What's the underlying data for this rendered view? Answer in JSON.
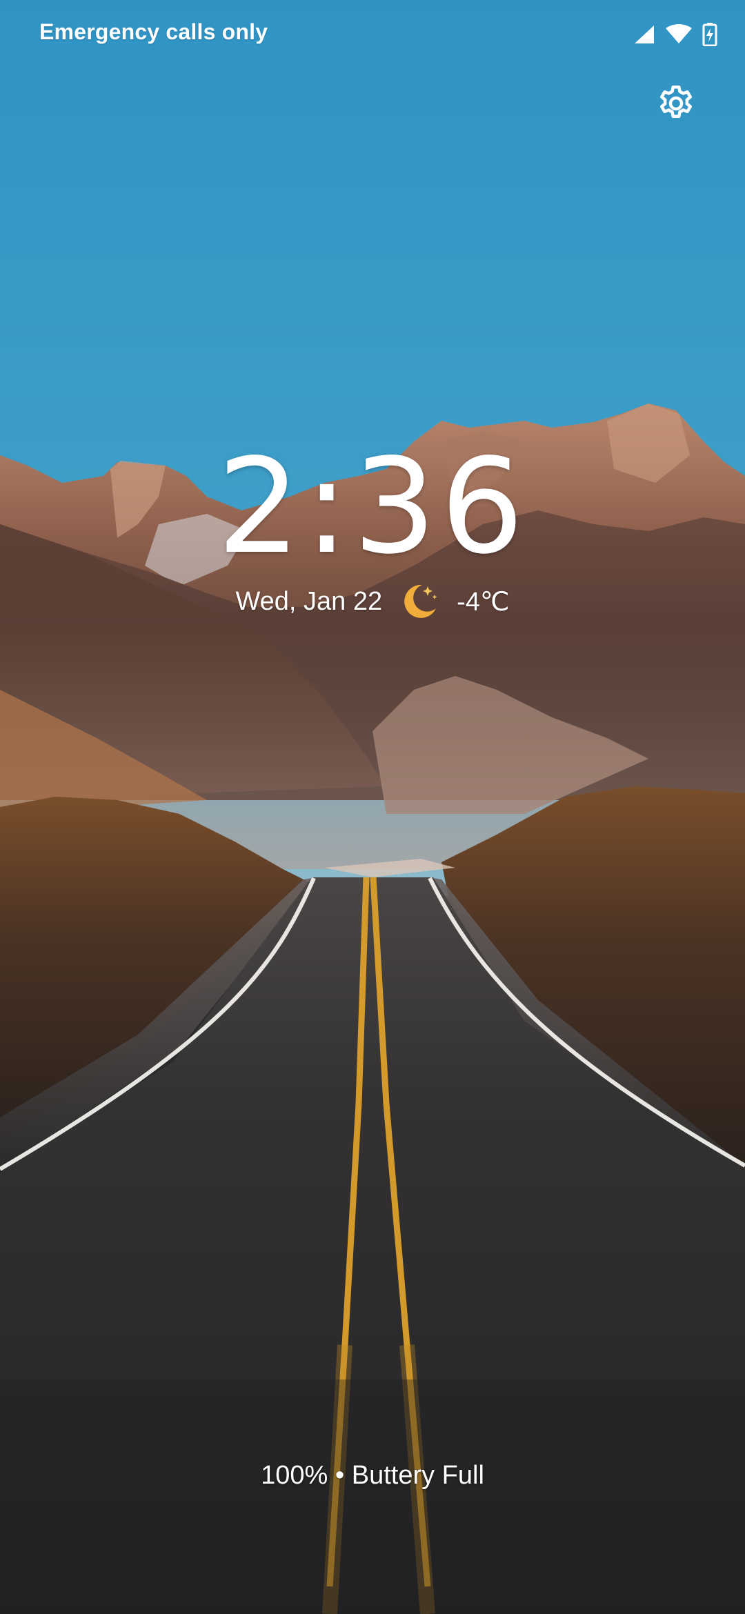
{
  "status_bar": {
    "carrier_text": "Emergency calls only",
    "icons": [
      "signal-icon",
      "wifi-icon",
      "battery-charging-icon"
    ]
  },
  "lock_screen": {
    "settings_icon": "gear-icon",
    "time": "2:36",
    "date": "Wed, Jan 22",
    "weather_icon": "moon-night-icon",
    "temperature": "-4℃",
    "battery_status": "100% • Buttery Full"
  },
  "colors": {
    "sky_top": "#2f95c8",
    "sky_bottom": "#6fb0cf",
    "road_line": "#e2a12a",
    "weather_moon": "#f4b13d"
  }
}
